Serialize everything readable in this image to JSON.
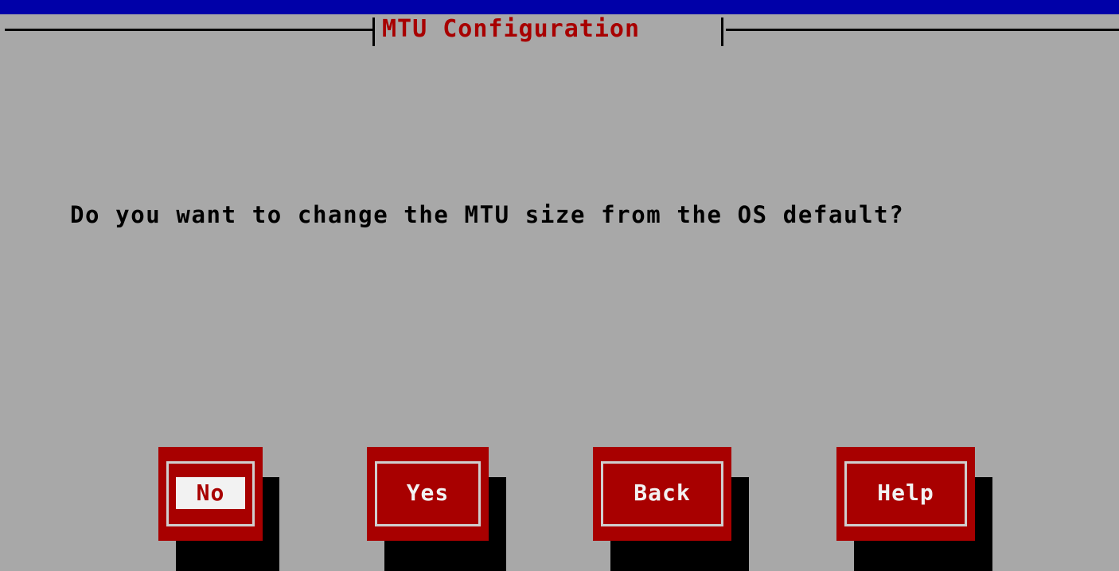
{
  "colors": {
    "background": "#a8a8a8",
    "top_bar": "#0000a8",
    "accent": "#a80000",
    "text": "#000000",
    "button_text": "#f2f2f2"
  },
  "dialog": {
    "title": "MTU Configuration",
    "prompt": "Do you want to change the MTU size from the OS default?"
  },
  "buttons": [
    {
      "label": "No",
      "focused": true
    },
    {
      "label": "Yes",
      "focused": false
    },
    {
      "label": "Back",
      "focused": false
    },
    {
      "label": "Help",
      "focused": false
    }
  ]
}
